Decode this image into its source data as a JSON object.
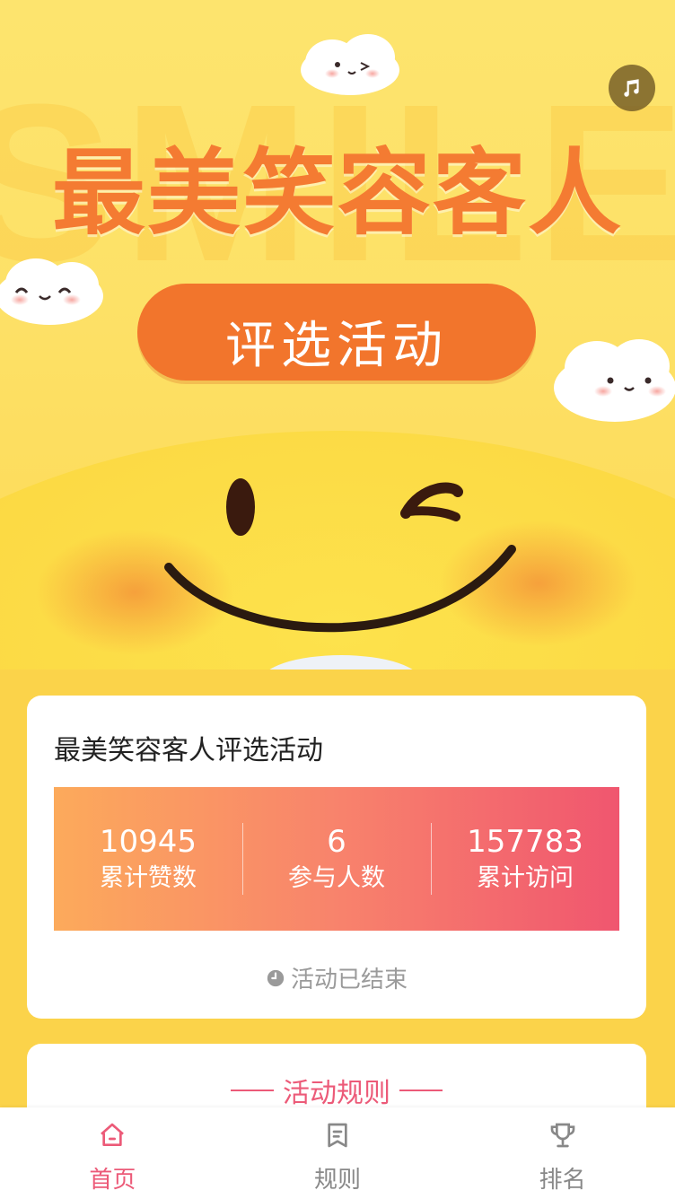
{
  "banner": {
    "background_word": "SMILE",
    "title": "最美笑容客人",
    "subtitle": "评选活动",
    "music_icon": "music-note-icon"
  },
  "activity": {
    "title": "最美笑容客人评选活动",
    "stats": [
      {
        "value": "10945",
        "label": "累计赞数"
      },
      {
        "value": "6",
        "label": "参与人数"
      },
      {
        "value": "157783",
        "label": "累计访问"
      }
    ],
    "status_icon": "clock-icon",
    "status": "活动已结束"
  },
  "rules": {
    "heading": "活动规则"
  },
  "nav": {
    "items": [
      {
        "label": "首页",
        "icon": "home-icon",
        "active": true
      },
      {
        "label": "规则",
        "icon": "rules-icon",
        "active": false
      },
      {
        "label": "排名",
        "icon": "trophy-icon",
        "active": false
      }
    ]
  },
  "colors": {
    "accent": "#ec5a78",
    "banner_orange": "#f47b32",
    "stats_gradient_start": "#fcaa5b",
    "stats_gradient_end": "#f0566f",
    "page_background": "#fbd34a"
  }
}
